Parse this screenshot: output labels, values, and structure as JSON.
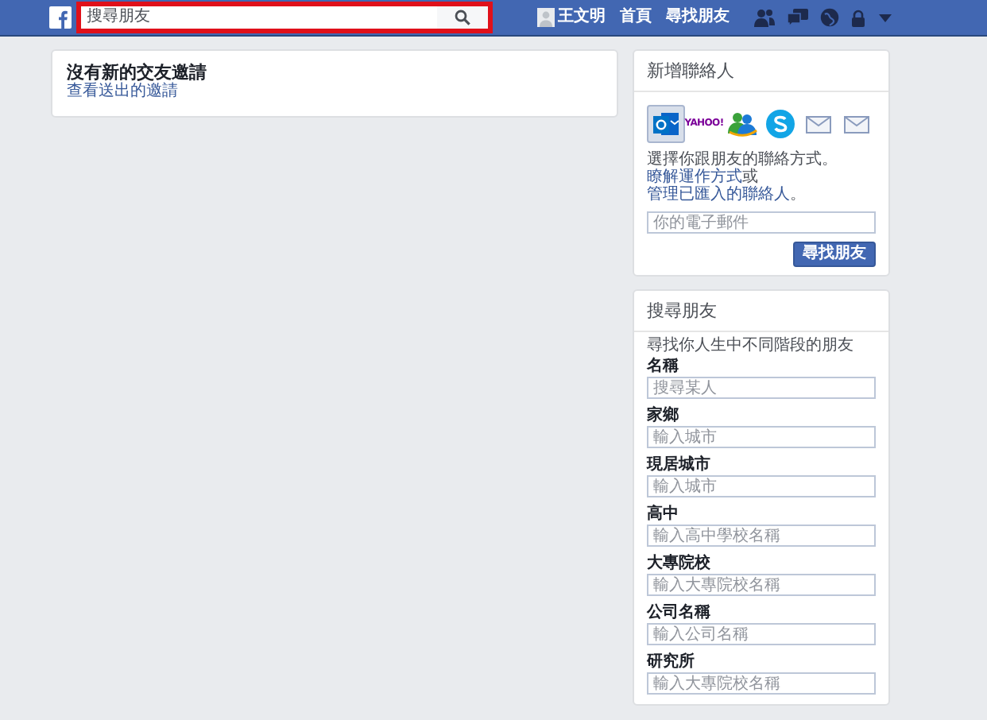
{
  "topbar": {
    "search": {
      "placeholder": "搜尋朋友"
    },
    "user": "王文明",
    "links": [
      "首頁",
      "尋找朋友"
    ]
  },
  "requests": {
    "title": "沒有新的交友邀請",
    "link": "查看送出的邀請"
  },
  "add_contacts": {
    "title": "新增聯絡人",
    "providers": [
      {
        "kind": "outlook",
        "selected": true
      },
      {
        "kind": "yahoo",
        "label": "YAHOO!",
        "selected": false
      },
      {
        "kind": "messenger",
        "selected": false
      },
      {
        "kind": "skype",
        "selected": false
      },
      {
        "kind": "mail",
        "selected": false
      },
      {
        "kind": "mail",
        "selected": false
      }
    ],
    "description": {
      "text": "選擇你跟朋友的聯絡方式。",
      "link_1": "瞭解運作方式",
      "joiner": "或",
      "link_2": "管理已匯入的聯絡人",
      "end": "。"
    },
    "email": {
      "placeholder": "你的電子郵件"
    },
    "button": "尋找朋友"
  },
  "search_friends": {
    "title": "搜尋朋友",
    "subtitle": "尋找你人生中不同階段的朋友",
    "fields": [
      {
        "label": "名稱",
        "placeholder": "搜尋某人"
      },
      {
        "label": "家鄉",
        "placeholder": "輸入城市"
      },
      {
        "label": "現居城市",
        "placeholder": "輸入城市"
      },
      {
        "label": "高中",
        "placeholder": "輸入高中學校名稱"
      },
      {
        "label": "大專院校",
        "placeholder": "輸入大專院校名稱"
      },
      {
        "label": "公司名稱",
        "placeholder": "輸入公司名稱"
      },
      {
        "label": "研究所",
        "placeholder": "輸入大專院校名稱"
      }
    ]
  }
}
